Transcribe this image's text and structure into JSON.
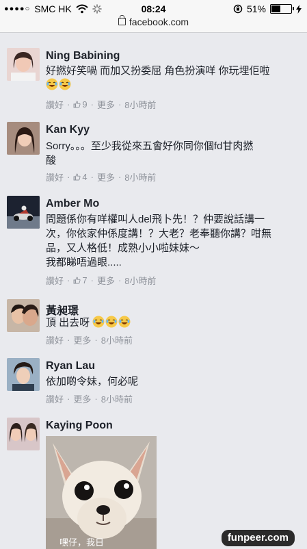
{
  "status_bar": {
    "signal_dots": "●●●●○",
    "carrier": "SMC HK",
    "time": "08:24",
    "battery_percent": "51%",
    "battery_level": 0.51
  },
  "url_bar": {
    "domain": "facebook.com"
  },
  "comments": [
    {
      "name": "Ning Babining",
      "lines": [
        "好撚好笑喎 而加又扮委屈 角色扮演咩 你玩埋佢啦"
      ],
      "emoji_count": 2,
      "like_label": "讚好",
      "like_count": "9",
      "more_label": "更多",
      "time": "8小時前"
    },
    {
      "name": "Kan Kyy",
      "lines": [
        "Sorry。。。至少我從來五會好你同你個fd甘肉撚",
        "酸"
      ],
      "like_label": "讚好",
      "like_count": "4",
      "more_label": "更多",
      "time": "8小時前"
    },
    {
      "name": "Amber Mo",
      "lines": [
        "問題係你有咩權叫人del飛卜先！？仲要說話講一",
        "次，你依家仲係度講！？大老？老奉聽你講？咁無",
        "品，又人格低！成熟小小啦妹妹～",
        "我都睇唔過眼....."
      ],
      "like_label": "讚好",
      "like_count": "7",
      "more_label": "更多",
      "time": "8小時前"
    },
    {
      "name": "黃昶璟",
      "lines": [
        "頂 出去呀"
      ],
      "emoji_count": 3,
      "like_label": "讚好",
      "more_label": "更多",
      "time": "8小時前"
    },
    {
      "name": "Ryan Lau",
      "lines": [
        "依加啲令妹，何必呢"
      ],
      "like_label": "讚好",
      "more_label": "更多",
      "time": "8小時前"
    },
    {
      "name": "Kaying Poon",
      "image_caption": "嘿仔，我日"
    }
  ],
  "watermark": "funpeer.com",
  "colors": {
    "background": "#e9eaee",
    "text": "#1d2129",
    "meta": "#90949c"
  }
}
